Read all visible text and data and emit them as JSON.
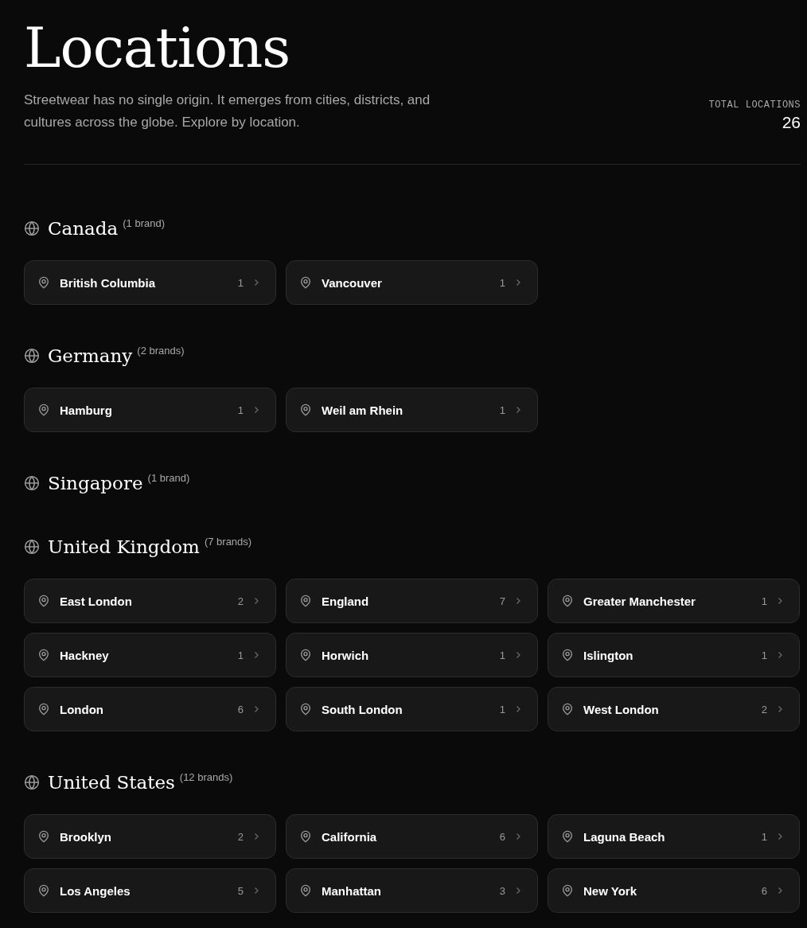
{
  "header": {
    "title": "Locations",
    "description": "Streetwear has no single origin. It emerges from cities, districts, and cultures across the globe. Explore by location.",
    "total_label": "TOTAL LOCATIONS",
    "total_value": "26"
  },
  "countries": [
    {
      "name": "Canada",
      "count": "(1 brand)",
      "locations": [
        {
          "name": "British Columbia",
          "count": "1"
        },
        {
          "name": "Vancouver",
          "count": "1"
        }
      ]
    },
    {
      "name": "Germany",
      "count": "(2 brands)",
      "locations": [
        {
          "name": "Hamburg",
          "count": "1"
        },
        {
          "name": "Weil am Rhein",
          "count": "1"
        }
      ]
    },
    {
      "name": "Singapore",
      "count": "(1 brand)"
    },
    {
      "name": "United Kingdom",
      "count": "(7 brands)",
      "locations": [
        {
          "name": "East London",
          "count": "2"
        },
        {
          "name": "England",
          "count": "7"
        },
        {
          "name": "Greater Manchester",
          "count": "1"
        },
        {
          "name": "Hackney",
          "count": "1"
        },
        {
          "name": "Horwich",
          "count": "1"
        },
        {
          "name": "Islington",
          "count": "1"
        },
        {
          "name": "London",
          "count": "6"
        },
        {
          "name": "South London",
          "count": "1"
        },
        {
          "name": "West London",
          "count": "2"
        }
      ]
    },
    {
      "name": "United States",
      "count": "(12 brands)",
      "locations": [
        {
          "name": "Brooklyn",
          "count": "2"
        },
        {
          "name": "California",
          "count": "6"
        },
        {
          "name": "Laguna Beach",
          "count": "1"
        },
        {
          "name": "Los Angeles",
          "count": "5"
        },
        {
          "name": "Manhattan",
          "count": "3"
        },
        {
          "name": "New York",
          "count": "6"
        }
      ]
    }
  ]
}
